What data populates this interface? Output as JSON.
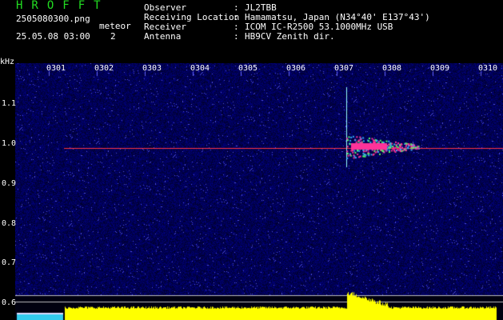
{
  "header": {
    "app_title": "HROFFT",
    "filename": "2505080300.png",
    "datetime": "25.05.08 03:00",
    "meteor_label": "meteor",
    "meteor_count": "2"
  },
  "info": [
    {
      "key": "Observer",
      "value": "JL2TBB"
    },
    {
      "key": "Receiving Location",
      "value": "Hamamatsu, Japan (N34°40' E137°43')"
    },
    {
      "key": "Receiver",
      "value": "ICOM IC-R2500 53.1000MHz USB"
    },
    {
      "key": "Antenna",
      "value": "HB9CV Zenith dir."
    }
  ],
  "axes": {
    "y_unit": "kHz",
    "y_ticks": [
      "1.1",
      "1.0",
      "0.9",
      "0.8",
      "0.7",
      "0.6"
    ],
    "x_ticks": [
      "0301",
      "0302",
      "0303",
      "0304",
      "0305",
      "0306",
      "0307",
      "0308",
      "0309",
      "0310"
    ]
  },
  "colors": {
    "title_green": "#22dd22",
    "background": "#000000",
    "noise_blue": "#0a0a90",
    "carrier_red": "#ff3344",
    "meteor_pink": "#ff3399",
    "meteor_green": "#55ff66",
    "baseline_yellow": "#ffff00",
    "tick_blue": "#6666ff"
  }
}
